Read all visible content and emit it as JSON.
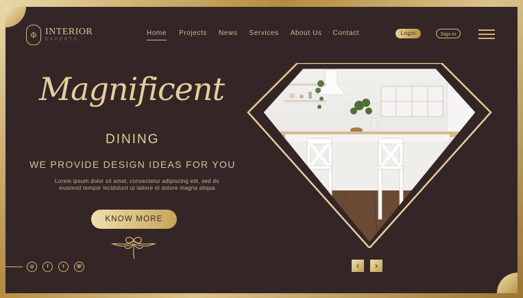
{
  "brand": {
    "name": "INTERIOR",
    "sub": "EXPERTS",
    "emblem": "Φ"
  },
  "nav": {
    "items": [
      {
        "label": "Home",
        "active": true
      },
      {
        "label": "Projects",
        "active": false
      },
      {
        "label": "News",
        "active": false
      },
      {
        "label": "Services",
        "active": false
      },
      {
        "label": "About Us",
        "active": false
      },
      {
        "label": "Contact",
        "active": false
      }
    ],
    "login": "Login",
    "signin": "Sign in"
  },
  "hero": {
    "title": "Magnificent",
    "subtitle": "DINING",
    "tagline": "WE PROVIDE DESIGN IDEAS FOR YOU",
    "body_line1": "Lorem ipsum dolor sit amet, consectetur adipiscing elit, sed do",
    "body_line2": "eiusmod tempor incididunt ut labore et dolore magna aliqua",
    "cta": "KNOW MORE"
  },
  "social": [
    "instagram-icon",
    "facebook-icon",
    "twitter-icon",
    "whatsapp-icon"
  ],
  "slider": {
    "prev": "‹",
    "next": "›"
  },
  "colors": {
    "background": "#342527",
    "gold": "#d2b571",
    "text": "#e4cf9a"
  }
}
